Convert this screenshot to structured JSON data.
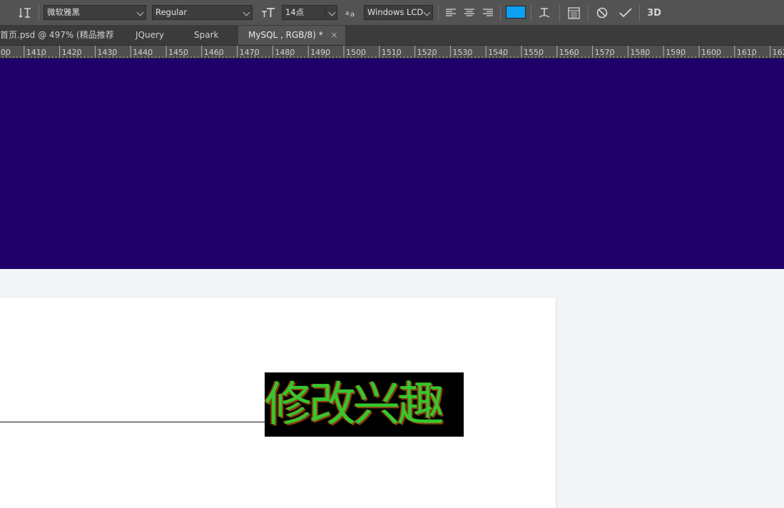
{
  "options_bar": {
    "font_family": "微软雅黑",
    "font_style": "Regular",
    "font_size": "14点",
    "anti_alias": "Windows LCD",
    "text_color": "#0ba1f4",
    "three_d_label": "3D",
    "icons": [
      "text-orientation-icon",
      "font-size-icon",
      "anti-alias-icon",
      "align-left-icon",
      "align-center-icon",
      "align-right-icon",
      "warp-text-icon",
      "character-panel-icon",
      "cancel-icon",
      "commit-icon",
      "3d-icon"
    ]
  },
  "tabs": [
    {
      "label": "首页.psd @ 497% (精品推荐"
    },
    {
      "label": "JQuery"
    },
    {
      "label": "Spark"
    },
    {
      "label": "MySQL , RGB/8) *",
      "close": "×"
    }
  ],
  "ruler": {
    "labels": [
      "00",
      "1410",
      "1420",
      "1430",
      "1440",
      "1450",
      "1460",
      "1470",
      "1480",
      "1490",
      "1500",
      "1510",
      "1520",
      "1530",
      "1540",
      "1550",
      "1560",
      "1570",
      "1580",
      "1590",
      "1600",
      "1610",
      "162"
    ]
  },
  "canvas": {
    "banner_color": "#1f006b",
    "pixel_text": "修改兴趣",
    "pixel_text_color": "#35c72f",
    "pixel_shadow_color": "#8a3d0c"
  }
}
